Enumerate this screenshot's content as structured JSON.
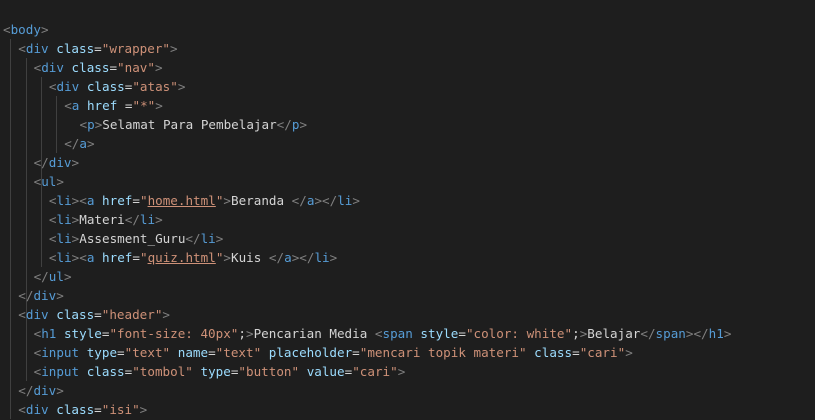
{
  "editor": {
    "language": "html",
    "colors": {
      "background": "#1e1e1e",
      "tag": "#569cd6",
      "bracket": "#808080",
      "attribute": "#9cdcfe",
      "string": "#ce9178",
      "text": "#d4d4d4"
    },
    "lines": [
      {
        "indent": 0,
        "tokens": [
          {
            "t": "b",
            "v": "<"
          },
          {
            "t": "tag",
            "v": "body"
          },
          {
            "t": "b",
            "v": ">"
          }
        ]
      },
      {
        "indent": 1,
        "tokens": [
          {
            "t": "b",
            "v": "<"
          },
          {
            "t": "tag",
            "v": "div"
          },
          {
            "t": "txt",
            "v": " "
          },
          {
            "t": "attr",
            "v": "class"
          },
          {
            "t": "txt",
            "v": "="
          },
          {
            "t": "str",
            "v": "\"wrapper\""
          },
          {
            "t": "b",
            "v": ">"
          }
        ]
      },
      {
        "indent": 2,
        "tokens": [
          {
            "t": "b",
            "v": "<"
          },
          {
            "t": "tag",
            "v": "div"
          },
          {
            "t": "txt",
            "v": " "
          },
          {
            "t": "attr",
            "v": "class"
          },
          {
            "t": "txt",
            "v": "="
          },
          {
            "t": "str",
            "v": "\"nav\""
          },
          {
            "t": "b",
            "v": ">"
          }
        ]
      },
      {
        "indent": 3,
        "tokens": [
          {
            "t": "b",
            "v": "<"
          },
          {
            "t": "tag",
            "v": "div"
          },
          {
            "t": "txt",
            "v": " "
          },
          {
            "t": "attr",
            "v": "class"
          },
          {
            "t": "txt",
            "v": "="
          },
          {
            "t": "str",
            "v": "\"atas\""
          },
          {
            "t": "b",
            "v": ">"
          }
        ]
      },
      {
        "indent": 4,
        "tokens": [
          {
            "t": "b",
            "v": "<"
          },
          {
            "t": "tag",
            "v": "a"
          },
          {
            "t": "txt",
            "v": " "
          },
          {
            "t": "attr",
            "v": "href"
          },
          {
            "t": "txt",
            "v": " ="
          },
          {
            "t": "str",
            "v": "\"*\""
          },
          {
            "t": "b",
            "v": ">"
          }
        ]
      },
      {
        "indent": 5,
        "tokens": [
          {
            "t": "b",
            "v": "<"
          },
          {
            "t": "tag",
            "v": "p"
          },
          {
            "t": "b",
            "v": ">"
          },
          {
            "t": "txt",
            "v": "Selamat Para Pembelajar"
          },
          {
            "t": "b",
            "v": "</"
          },
          {
            "t": "tag",
            "v": "p"
          },
          {
            "t": "b",
            "v": ">"
          }
        ]
      },
      {
        "indent": 4,
        "tokens": [
          {
            "t": "b",
            "v": "</"
          },
          {
            "t": "tag",
            "v": "a"
          },
          {
            "t": "b",
            "v": ">"
          }
        ]
      },
      {
        "indent": 2,
        "tokens": [
          {
            "t": "b",
            "v": "</"
          },
          {
            "t": "tag",
            "v": "div"
          },
          {
            "t": "b",
            "v": ">"
          }
        ]
      },
      {
        "indent": 2,
        "tokens": [
          {
            "t": "b",
            "v": "<"
          },
          {
            "t": "tag",
            "v": "ul"
          },
          {
            "t": "b",
            "v": ">"
          }
        ]
      },
      {
        "indent": 3,
        "tokens": [
          {
            "t": "b",
            "v": "<"
          },
          {
            "t": "tag",
            "v": "li"
          },
          {
            "t": "b",
            "v": ">"
          },
          {
            "t": "b",
            "v": "<"
          },
          {
            "t": "tag",
            "v": "a"
          },
          {
            "t": "txt",
            "v": " "
          },
          {
            "t": "attr",
            "v": "href"
          },
          {
            "t": "txt",
            "v": "="
          },
          {
            "t": "str",
            "v": "\""
          },
          {
            "t": "link",
            "v": "home.html"
          },
          {
            "t": "str",
            "v": "\""
          },
          {
            "t": "b",
            "v": ">"
          },
          {
            "t": "txt",
            "v": "Beranda "
          },
          {
            "t": "b",
            "v": "</"
          },
          {
            "t": "tag",
            "v": "a"
          },
          {
            "t": "b",
            "v": ">"
          },
          {
            "t": "b",
            "v": "</"
          },
          {
            "t": "tag",
            "v": "li"
          },
          {
            "t": "b",
            "v": ">"
          }
        ]
      },
      {
        "indent": 3,
        "tokens": [
          {
            "t": "b",
            "v": "<"
          },
          {
            "t": "tag",
            "v": "li"
          },
          {
            "t": "b",
            "v": ">"
          },
          {
            "t": "txt",
            "v": "Materi"
          },
          {
            "t": "b",
            "v": "</"
          },
          {
            "t": "tag",
            "v": "li"
          },
          {
            "t": "b",
            "v": ">"
          }
        ]
      },
      {
        "indent": 3,
        "tokens": [
          {
            "t": "b",
            "v": "<"
          },
          {
            "t": "tag",
            "v": "li"
          },
          {
            "t": "b",
            "v": ">"
          },
          {
            "t": "txt",
            "v": "Assesment_Guru"
          },
          {
            "t": "b",
            "v": "</"
          },
          {
            "t": "tag",
            "v": "li"
          },
          {
            "t": "b",
            "v": ">"
          }
        ]
      },
      {
        "indent": 3,
        "tokens": [
          {
            "t": "b",
            "v": "<"
          },
          {
            "t": "tag",
            "v": "li"
          },
          {
            "t": "b",
            "v": ">"
          },
          {
            "t": "b",
            "v": "<"
          },
          {
            "t": "tag",
            "v": "a"
          },
          {
            "t": "txt",
            "v": " "
          },
          {
            "t": "attr",
            "v": "href"
          },
          {
            "t": "txt",
            "v": "="
          },
          {
            "t": "str",
            "v": "\""
          },
          {
            "t": "link",
            "v": "quiz.html"
          },
          {
            "t": "str",
            "v": "\""
          },
          {
            "t": "b",
            "v": ">"
          },
          {
            "t": "txt",
            "v": "Kuis "
          },
          {
            "t": "b",
            "v": "</"
          },
          {
            "t": "tag",
            "v": "a"
          },
          {
            "t": "b",
            "v": ">"
          },
          {
            "t": "b",
            "v": "</"
          },
          {
            "t": "tag",
            "v": "li"
          },
          {
            "t": "b",
            "v": ">"
          }
        ]
      },
      {
        "indent": 2,
        "tokens": [
          {
            "t": "b",
            "v": "</"
          },
          {
            "t": "tag",
            "v": "ul"
          },
          {
            "t": "b",
            "v": ">"
          }
        ]
      },
      {
        "indent": 1,
        "tokens": [
          {
            "t": "b",
            "v": "</"
          },
          {
            "t": "tag",
            "v": "div"
          },
          {
            "t": "b",
            "v": ">"
          }
        ]
      },
      {
        "indent": 1,
        "tokens": [
          {
            "t": "b",
            "v": "<"
          },
          {
            "t": "tag",
            "v": "div"
          },
          {
            "t": "txt",
            "v": " "
          },
          {
            "t": "attr",
            "v": "class"
          },
          {
            "t": "txt",
            "v": "="
          },
          {
            "t": "str",
            "v": "\"header\""
          },
          {
            "t": "b",
            "v": ">"
          }
        ]
      },
      {
        "indent": 2,
        "tokens": [
          {
            "t": "b",
            "v": "<"
          },
          {
            "t": "tag",
            "v": "h1"
          },
          {
            "t": "txt",
            "v": " "
          },
          {
            "t": "attr",
            "v": "style"
          },
          {
            "t": "txt",
            "v": "="
          },
          {
            "t": "str",
            "v": "\"font-size: 40px\""
          },
          {
            "t": "txt",
            "v": ";"
          },
          {
            "t": "b",
            "v": ">"
          },
          {
            "t": "txt",
            "v": "Pencarian Media "
          },
          {
            "t": "b",
            "v": "<"
          },
          {
            "t": "tag",
            "v": "span"
          },
          {
            "t": "txt",
            "v": " "
          },
          {
            "t": "attr",
            "v": "style"
          },
          {
            "t": "txt",
            "v": "="
          },
          {
            "t": "str",
            "v": "\"color: white\""
          },
          {
            "t": "txt",
            "v": ";"
          },
          {
            "t": "b",
            "v": ">"
          },
          {
            "t": "txt",
            "v": "Belajar"
          },
          {
            "t": "b",
            "v": "</"
          },
          {
            "t": "tag",
            "v": "span"
          },
          {
            "t": "b",
            "v": ">"
          },
          {
            "t": "b",
            "v": "</"
          },
          {
            "t": "tag",
            "v": "h1"
          },
          {
            "t": "b",
            "v": ">"
          }
        ]
      },
      {
        "indent": 2,
        "tokens": [
          {
            "t": "b",
            "v": "<"
          },
          {
            "t": "tag",
            "v": "input"
          },
          {
            "t": "txt",
            "v": " "
          },
          {
            "t": "attr",
            "v": "type"
          },
          {
            "t": "txt",
            "v": "="
          },
          {
            "t": "str",
            "v": "\"text\""
          },
          {
            "t": "txt",
            "v": " "
          },
          {
            "t": "attr",
            "v": "name"
          },
          {
            "t": "txt",
            "v": "="
          },
          {
            "t": "str",
            "v": "\"text\""
          },
          {
            "t": "txt",
            "v": " "
          },
          {
            "t": "attr",
            "v": "placeholder"
          },
          {
            "t": "txt",
            "v": "="
          },
          {
            "t": "str",
            "v": "\"mencari topik materi\""
          },
          {
            "t": "txt",
            "v": " "
          },
          {
            "t": "attr",
            "v": "class"
          },
          {
            "t": "txt",
            "v": "="
          },
          {
            "t": "str",
            "v": "\"cari\""
          },
          {
            "t": "b",
            "v": ">"
          }
        ]
      },
      {
        "indent": 2,
        "tokens": [
          {
            "t": "b",
            "v": "<"
          },
          {
            "t": "tag",
            "v": "input"
          },
          {
            "t": "txt",
            "v": " "
          },
          {
            "t": "attr",
            "v": "class"
          },
          {
            "t": "txt",
            "v": "="
          },
          {
            "t": "str",
            "v": "\"tombol\""
          },
          {
            "t": "txt",
            "v": " "
          },
          {
            "t": "attr",
            "v": "type"
          },
          {
            "t": "txt",
            "v": "="
          },
          {
            "t": "str",
            "v": "\"button\""
          },
          {
            "t": "txt",
            "v": " "
          },
          {
            "t": "attr",
            "v": "value"
          },
          {
            "t": "txt",
            "v": "="
          },
          {
            "t": "str",
            "v": "\"cari\""
          },
          {
            "t": "b",
            "v": ">"
          }
        ]
      },
      {
        "indent": 1,
        "tokens": [
          {
            "t": "b",
            "v": "</"
          },
          {
            "t": "tag",
            "v": "div"
          },
          {
            "t": "b",
            "v": ">"
          }
        ]
      },
      {
        "indent": 1,
        "tokens": [
          {
            "t": "b",
            "v": "<"
          },
          {
            "t": "tag",
            "v": "div"
          },
          {
            "t": "txt",
            "v": " "
          },
          {
            "t": "attr",
            "v": "class"
          },
          {
            "t": "txt",
            "v": "="
          },
          {
            "t": "str",
            "v": "\"isi\""
          },
          {
            "t": "b",
            "v": ">"
          }
        ]
      }
    ]
  }
}
